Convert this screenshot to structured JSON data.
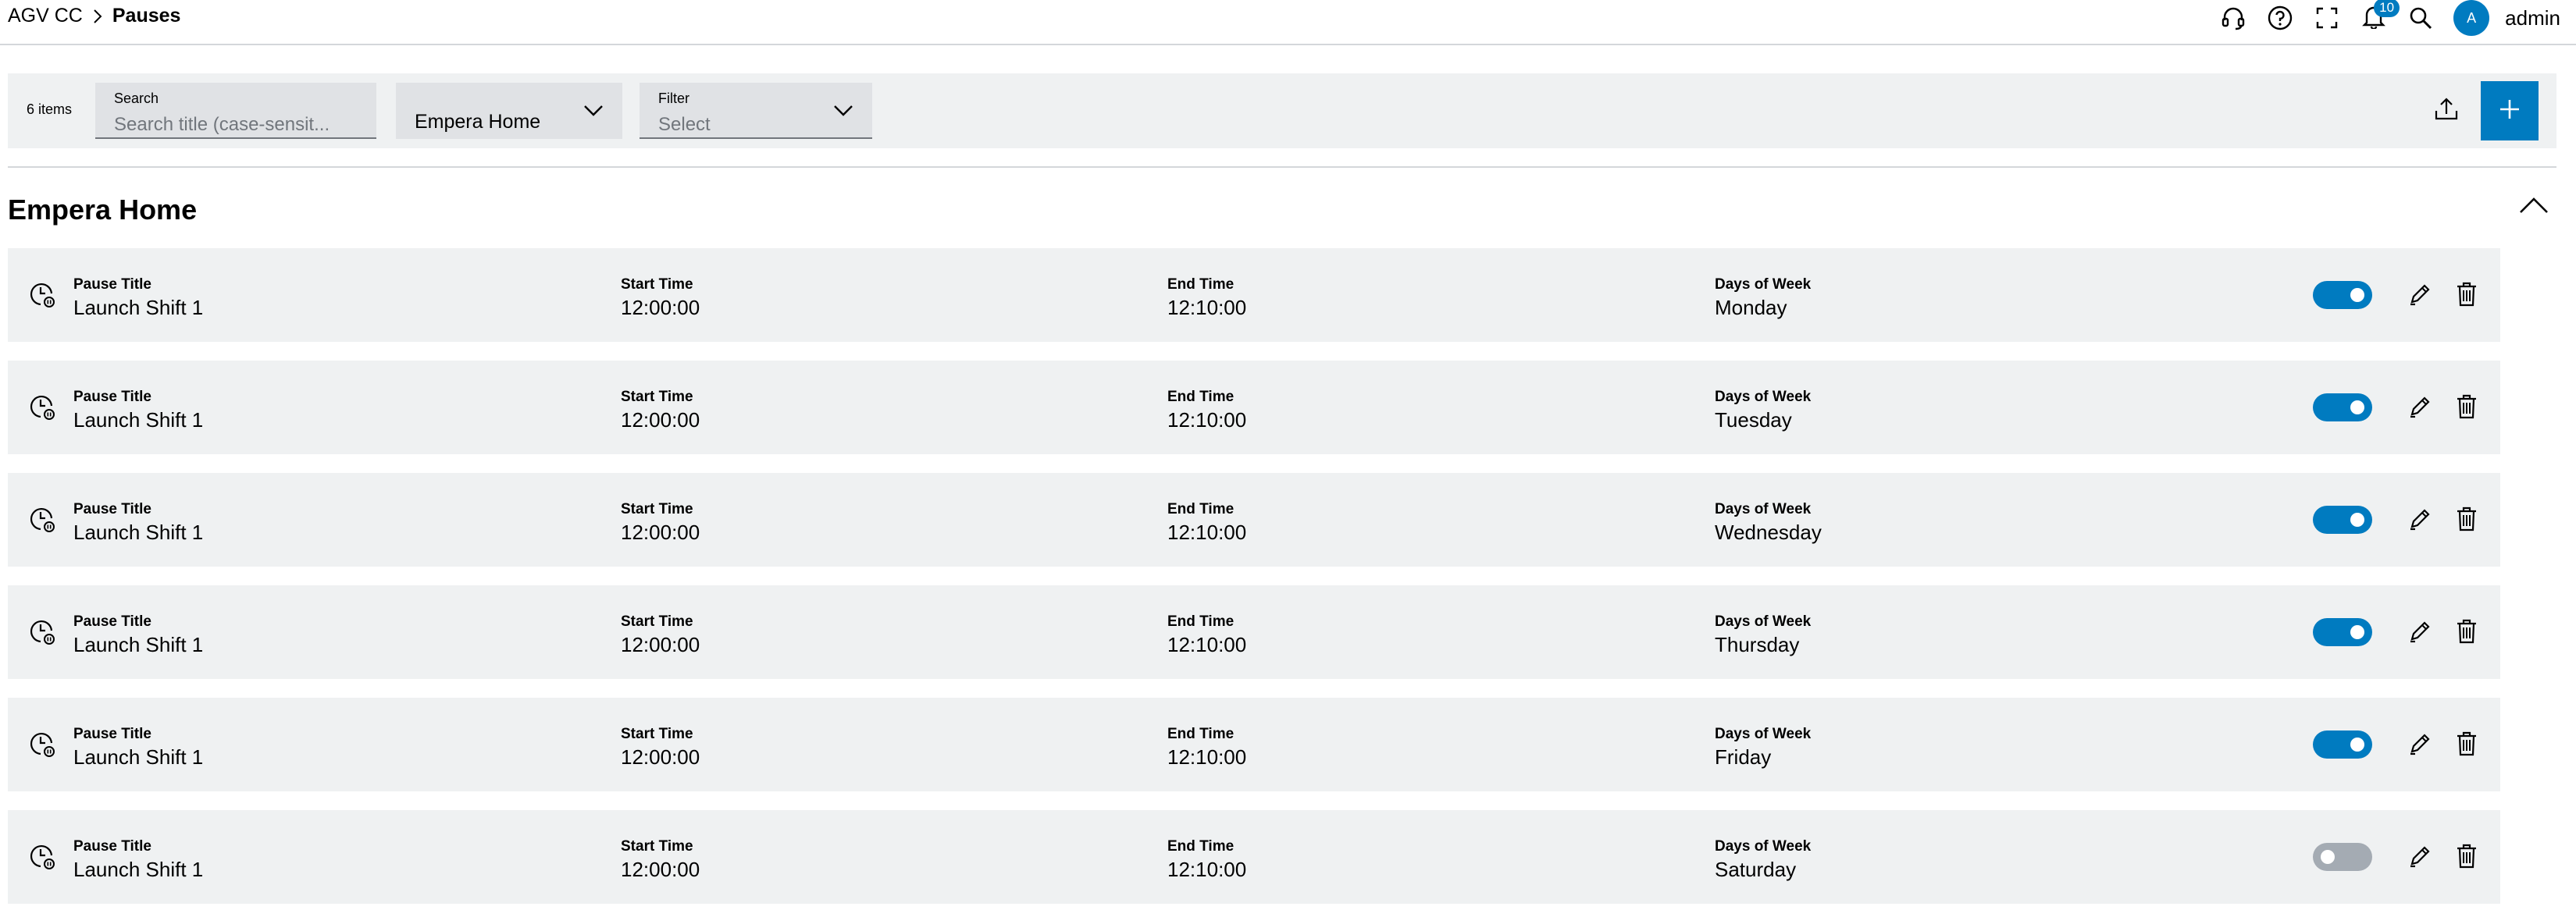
{
  "breadcrumb": {
    "parent": "AGV CC",
    "current": "Pauses"
  },
  "header": {
    "notification_count": "10",
    "avatar_initial": "A",
    "user_name": "admin"
  },
  "toolbar": {
    "item_count": "6 items",
    "search": {
      "label": "Search",
      "placeholder": "Search title (case-sensit..."
    },
    "location_select": {
      "value": "Empera Home"
    },
    "filter": {
      "label": "Filter",
      "value": "Select"
    }
  },
  "group": {
    "title": "Empera Home"
  },
  "columns": {
    "title": "Pause Title",
    "start": "Start Time",
    "end": "End Time",
    "days": "Days of Week"
  },
  "rows": [
    {
      "title": "Launch Shift 1",
      "start": "12:00:00",
      "end": "12:10:00",
      "days": "Monday",
      "enabled": true
    },
    {
      "title": "Launch Shift 1",
      "start": "12:00:00",
      "end": "12:10:00",
      "days": "Tuesday",
      "enabled": true
    },
    {
      "title": "Launch Shift 1",
      "start": "12:00:00",
      "end": "12:10:00",
      "days": "Wednesday",
      "enabled": true
    },
    {
      "title": "Launch Shift 1",
      "start": "12:00:00",
      "end": "12:10:00",
      "days": "Thursday",
      "enabled": true
    },
    {
      "title": "Launch Shift 1",
      "start": "12:00:00",
      "end": "12:10:00",
      "days": "Friday",
      "enabled": true
    },
    {
      "title": "Launch Shift 1",
      "start": "12:00:00",
      "end": "12:10:00",
      "days": "Saturday",
      "enabled": false
    }
  ],
  "colors": {
    "accent": "#007bc0",
    "row_bg": "#eff1f2",
    "field_bg": "#e0e2e5",
    "toggle_off": "#a4abb3"
  },
  "icons": [
    "chevron-right-icon",
    "headset-icon",
    "help-icon",
    "fullscreen-icon",
    "bell-icon",
    "search-icon",
    "chevron-down-icon",
    "upload-icon",
    "plus-icon",
    "chevron-up-icon",
    "clock-pause-icon",
    "pencil-icon",
    "trash-icon"
  ]
}
